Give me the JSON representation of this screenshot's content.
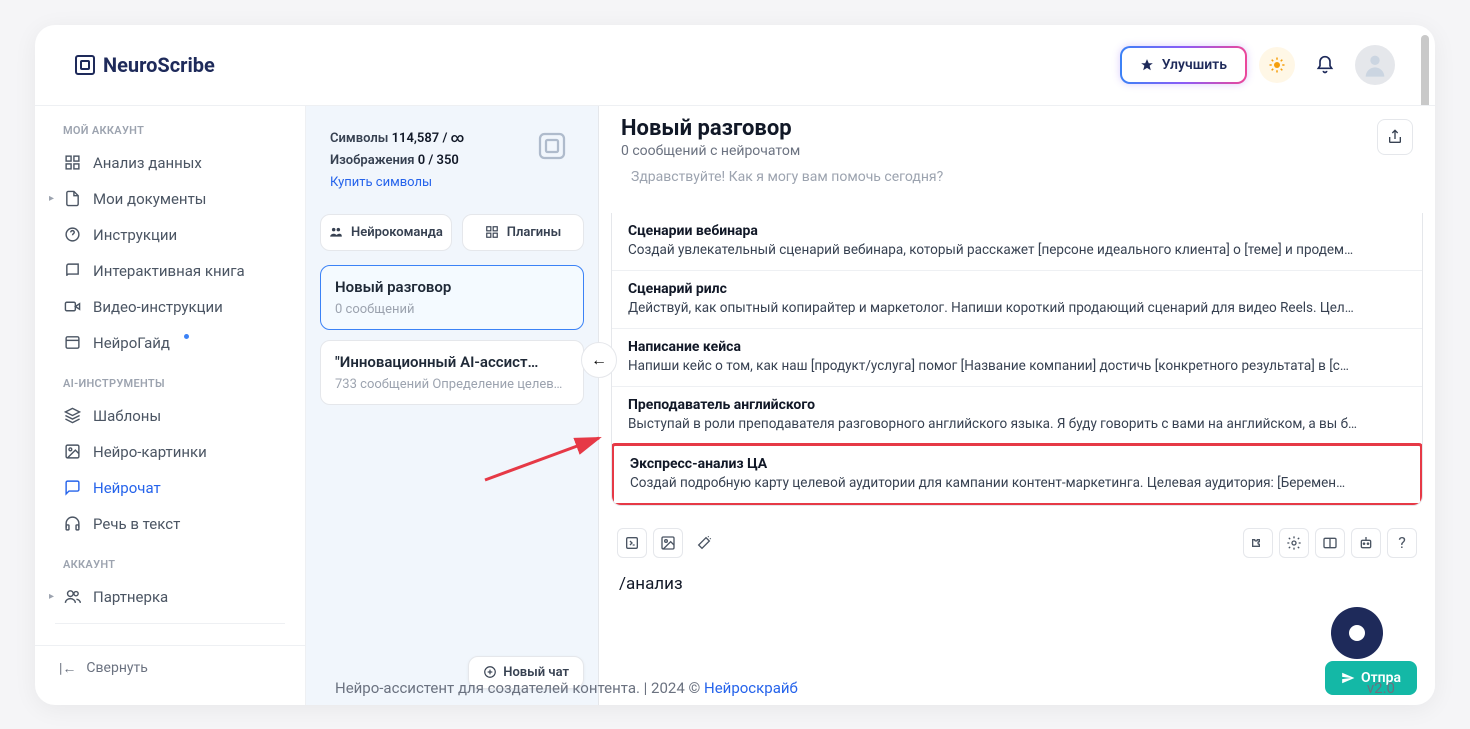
{
  "brand": "NeuroScribe",
  "top": {
    "upgrade": "Улучшить"
  },
  "sidebar": {
    "section_account": "МОЙ АККАУНТ",
    "items_account": [
      {
        "icon": "grid",
        "label": "Анализ данных"
      },
      {
        "icon": "doc",
        "label": "Мои документы",
        "caret": true
      },
      {
        "icon": "help",
        "label": "Инструкции"
      },
      {
        "icon": "book",
        "label": "Интерактивная книга"
      },
      {
        "icon": "video",
        "label": "Видео-инструкции"
      },
      {
        "icon": "guide",
        "label": "НейроГайд",
        "dot": true
      }
    ],
    "section_tools": "AI-ИНСТРУМЕНТЫ",
    "items_tools": [
      {
        "icon": "layers",
        "label": "Шаблоны"
      },
      {
        "icon": "image",
        "label": "Нейро-картинки"
      },
      {
        "icon": "chat",
        "label": "Нейрочат",
        "active": true
      },
      {
        "icon": "headphones",
        "label": "Речь в текст"
      }
    ],
    "section_acct2": "АККАУНТ",
    "items_acct2": [
      {
        "icon": "users",
        "label": "Партнерка",
        "caret": true
      }
    ],
    "collapse": "Свернуть"
  },
  "usage": {
    "symbols_label": "Символы",
    "symbols_value": "114,587 / ∞",
    "images_label": "Изображения",
    "images_value": "0 / 350",
    "buy": "Купить символы"
  },
  "pills": {
    "team": "Нейрокоманда",
    "plugins": "Плагины"
  },
  "chats": [
    {
      "title": "Новый разговор",
      "sub": "0 сообщений",
      "active": true
    },
    {
      "title": "\"Инновационный AI-ассист…",
      "sub": "733 сообщений Определение целевы…"
    }
  ],
  "new_chat": "Новый чат",
  "conversation": {
    "title": "Новый разговор",
    "sub": "0 сообщений с нейрочатом",
    "ghost": "Здравствуйте! Как я могу вам помочь сегодня?",
    "templates": [
      {
        "title": "Сценарии вебинара",
        "desc": "Создай увлекательный сценарий вебинара, который расскажет [персоне идеального клиента] о [теме] и продем…"
      },
      {
        "title": "Сценарий рилс",
        "desc": "Действуй, как опытный копирайтер и маркетолог. Напиши короткий продающий сценарий для видео Reels. Цел…"
      },
      {
        "title": "Написание кейса",
        "desc": "Напиши кейс о том, как наш [продукт/услуга] помог [Название компании] достичь [конкретного результата] в [с…"
      },
      {
        "title": "Преподаватель английского",
        "desc": "Выступай в роли преподавателя разговорного английского языка. Я буду говорить с вами на английском, а вы б…"
      },
      {
        "title": "Экспресс-анализ ЦА",
        "desc": "Создай подробную карту целевой аудитории для кампании контент-маркетинга. Целевая аудитория: [Беремен…",
        "highlighted": true
      }
    ],
    "input_value": "/анализ",
    "send": "Отпра"
  },
  "footer": {
    "text_left": "Нейро-ассистент для создателей контента.  | 2024 © ",
    "link": "Нейроскрайб",
    "version": "v2.0"
  }
}
